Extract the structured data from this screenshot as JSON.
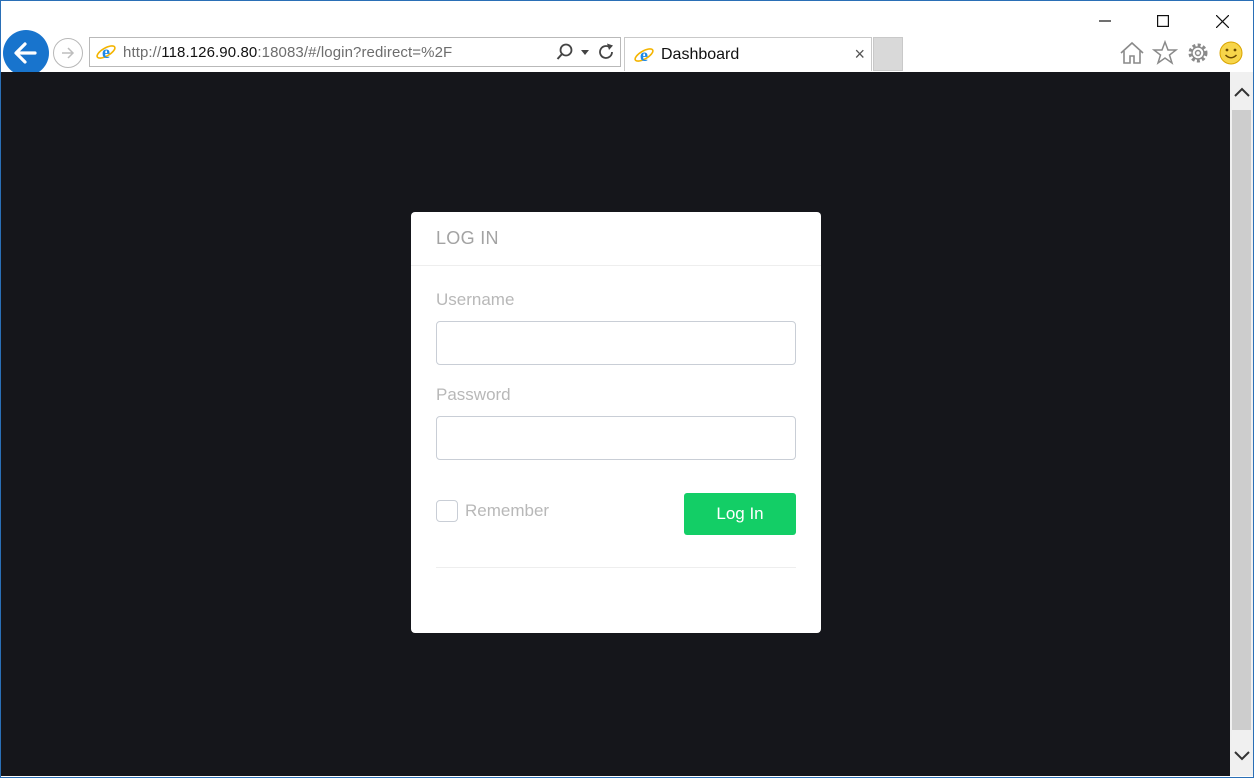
{
  "browser": {
    "address_url_prefix": "http://",
    "address_url_host": "118.126.90.80",
    "address_url_rest": ":18083/#/login?redirect=%2F",
    "tab_title": "Dashboard",
    "tab_close": "×"
  },
  "login": {
    "title": "LOG IN",
    "username_label": "Username",
    "password_label": "Password",
    "remember_label": "Remember",
    "login_button": "Log In"
  },
  "colors": {
    "page_background": "#15161b",
    "primary_button": "#13ce66",
    "browser_accent": "#1874cd"
  },
  "icons": [
    "back-arrow-icon",
    "forward-arrow-icon",
    "ie-logo-icon",
    "search-icon",
    "dropdown-icon",
    "refresh-icon",
    "home-icon",
    "star-icon",
    "gear-icon",
    "smiley-icon",
    "minimize-icon",
    "maximize-icon",
    "close-icon",
    "scroll-up-icon",
    "scroll-down-icon"
  ]
}
